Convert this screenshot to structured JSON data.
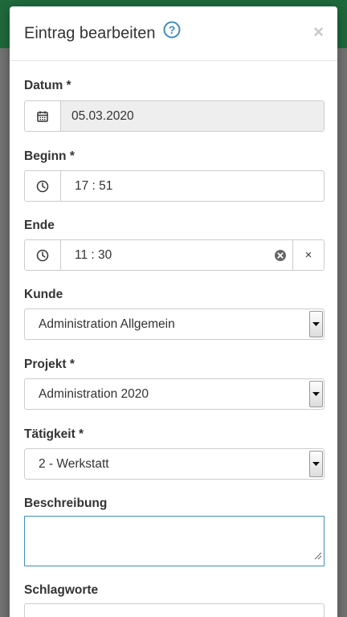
{
  "modal": {
    "title": "Eintrag bearbeiten",
    "help_icon": "help-circle-icon",
    "close_label": "×"
  },
  "form": {
    "datum": {
      "label": "Datum *",
      "value": "05.03.2020",
      "icon": "calendar-icon"
    },
    "beginn": {
      "label": "Beginn *",
      "value": "17 : 51",
      "icon": "clock-icon"
    },
    "ende": {
      "label": "Ende",
      "value": "11 : 30",
      "icon": "clock-icon",
      "clear_icon": "clear-circle-icon",
      "reset_label": "×"
    },
    "kunde": {
      "label": "Kunde",
      "value": "Administration Allgemein"
    },
    "projekt": {
      "label": "Projekt *",
      "value": "Administration 2020"
    },
    "taetigkeit": {
      "label": "Tätigkeit *",
      "value": "2 - Werkstatt"
    },
    "beschreibung": {
      "label": "Beschreibung",
      "value": ""
    },
    "schlagworte": {
      "label": "Schlagworte",
      "value": ""
    }
  },
  "colors": {
    "header_bar": "#1f6a3c",
    "accent": "#3c8dbc",
    "readonly_bg": "#eeeeee"
  }
}
